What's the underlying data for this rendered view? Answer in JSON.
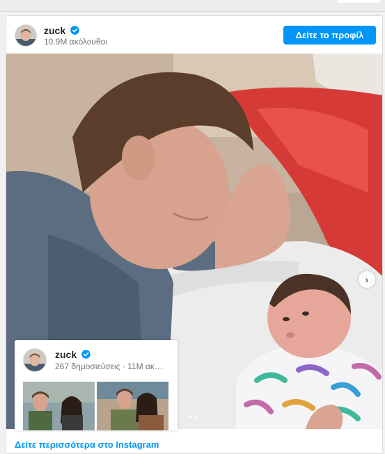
{
  "post": {
    "username": "zuck",
    "followers": "10.9M ακόλουθοι",
    "view_profile_label": "Δείτε το προφίλ",
    "next_icon": "chevron-right-icon",
    "carousel": {
      "slides": 2,
      "active": 1
    }
  },
  "profile_popup": {
    "username": "zuck",
    "stats": "267 δημοσιεύσεις · 11M ακ…"
  },
  "footer": {
    "link_label": "Δείτε περισσότερα στο Instagram"
  },
  "colors": {
    "accent": "#0095f6",
    "verified": "#0095f6",
    "text_primary": "#262626",
    "text_secondary": "#737373"
  }
}
